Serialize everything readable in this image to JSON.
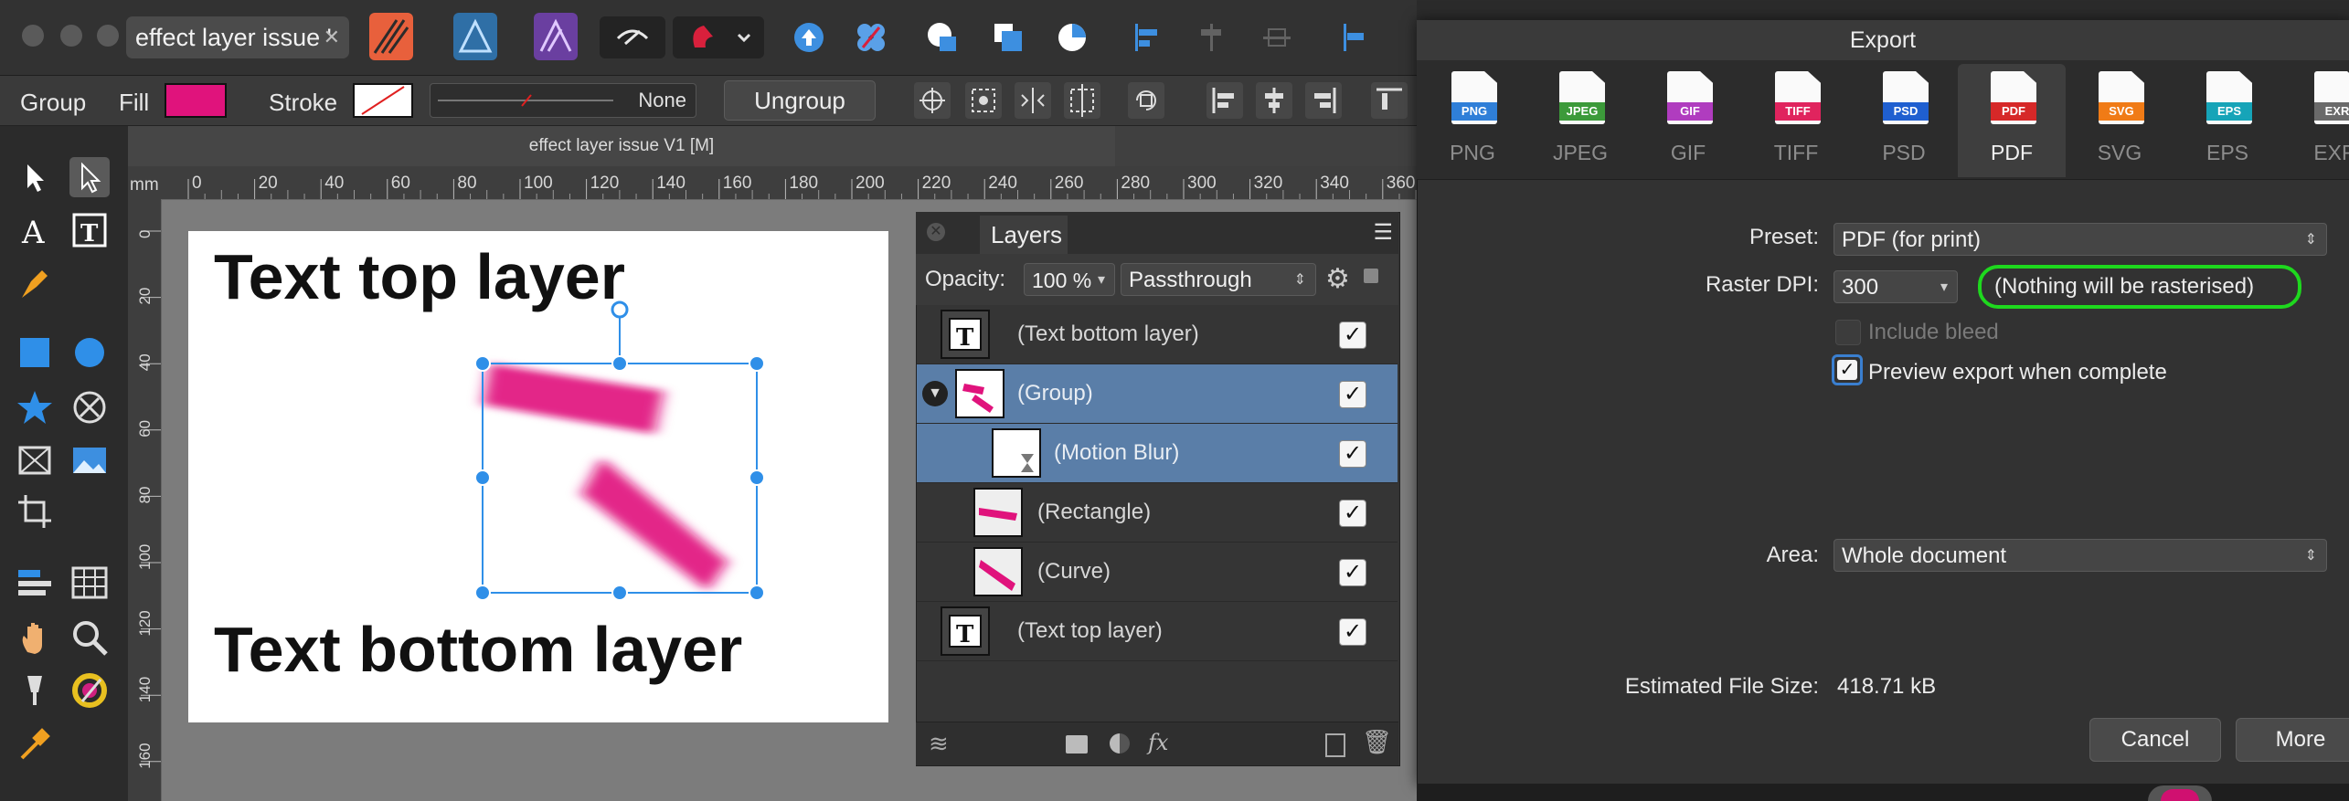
{
  "titlebar": {
    "document_tab": "effect layer issue '",
    "document_tab_close": "✕"
  },
  "context": {
    "group_label": "Group",
    "fill_label": "Fill",
    "stroke_label": "Stroke",
    "stroke_width": "None",
    "ungroup_label": "Ungroup",
    "fill_color": "#e0137c"
  },
  "document": {
    "tab_title": "effect layer issue V1 [M]",
    "ruler_unit": "mm",
    "h_ticks": [
      "0",
      "20",
      "40",
      "60",
      "80",
      "100",
      "120",
      "140",
      "160",
      "180",
      "200",
      "220",
      "240",
      "260",
      "280",
      "300",
      "320",
      "340",
      "360"
    ],
    "v_ticks": [
      "0",
      "20",
      "40",
      "60",
      "80",
      "100",
      "120",
      "140",
      "160"
    ],
    "text_top": "Text top layer",
    "text_bottom": "Text bottom layer"
  },
  "layers": {
    "title": "Layers",
    "opacity_label": "Opacity:",
    "opacity_value": "100 %",
    "blend_mode": "Passthrough",
    "rows": [
      {
        "name": "(Text bottom layer)",
        "checked": "✓"
      },
      {
        "name": "(Group)",
        "checked": "✓"
      },
      {
        "name": "(Motion Blur)",
        "checked": "✓"
      },
      {
        "name": "(Rectangle)",
        "checked": "✓"
      },
      {
        "name": "(Curve)",
        "checked": "✓"
      },
      {
        "name": "(Text top layer)",
        "checked": "✓"
      }
    ]
  },
  "export": {
    "title": "Export",
    "formats": [
      {
        "label": "PNG",
        "band": "PNG",
        "color": "#2f7fd8"
      },
      {
        "label": "JPEG",
        "band": "JPEG",
        "color": "#3c9a3a"
      },
      {
        "label": "GIF",
        "band": "GIF",
        "color": "#b03cbf"
      },
      {
        "label": "TIFF",
        "band": "TIFF",
        "color": "#e0245e"
      },
      {
        "label": "PSD",
        "band": "PSD",
        "color": "#1f5fd0"
      },
      {
        "label": "PDF",
        "band": "PDF",
        "color": "#d62828"
      },
      {
        "label": "SVG",
        "band": "SVG",
        "color": "#f07b16"
      },
      {
        "label": "EPS",
        "band": "EPS",
        "color": "#16a4b8"
      },
      {
        "label": "EXR",
        "band": "EXR",
        "color": "#6a6a6a"
      }
    ],
    "selected_format": "PDF",
    "preset_label": "Preset:",
    "preset_value": "PDF (for print)",
    "raster_label": "Raster DPI:",
    "raster_value": "300",
    "raster_note": "(Nothing will be rasterised)",
    "include_bleed": "Include bleed",
    "preview_label": "Preview export when complete",
    "preview_checked": "✓",
    "area_label": "Area:",
    "area_value": "Whole document",
    "filesize_label": "Estimated File Size:",
    "filesize_value": "418.71 kB",
    "cancel": "Cancel",
    "more": "More"
  }
}
